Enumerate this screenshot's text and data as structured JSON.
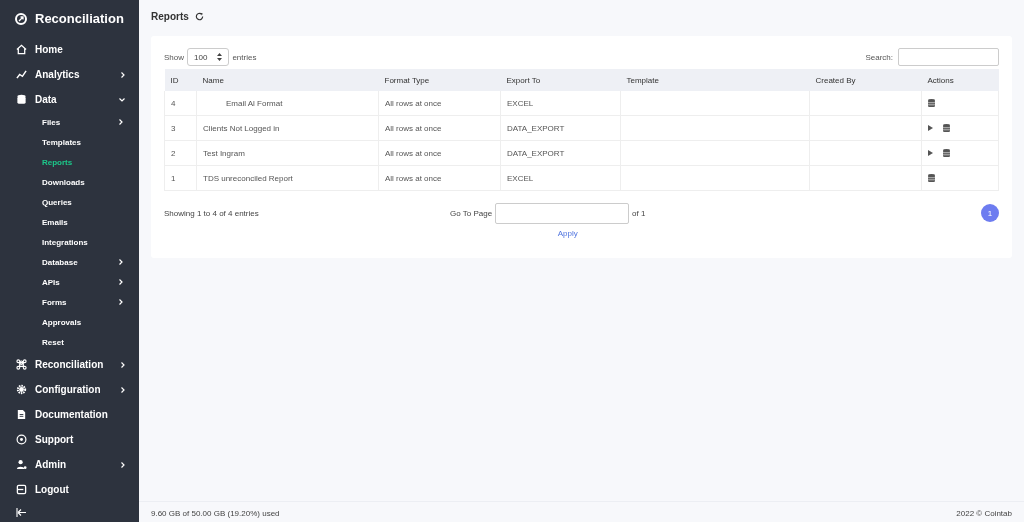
{
  "brand": "Reconciliation",
  "nav": [
    {
      "label": "Home",
      "expandable": false
    },
    {
      "label": "Analytics",
      "expandable": true,
      "expanded": false
    },
    {
      "label": "Data",
      "expandable": true,
      "expanded": true,
      "children": [
        {
          "label": "Files",
          "expandable": true,
          "selected": false
        },
        {
          "label": "Templates",
          "expandable": false,
          "selected": false
        },
        {
          "label": "Reports",
          "expandable": false,
          "selected": true
        },
        {
          "label": "Downloads",
          "expandable": false,
          "selected": false
        },
        {
          "label": "Queries",
          "expandable": false,
          "selected": false
        },
        {
          "label": "Emails",
          "expandable": false,
          "selected": false
        },
        {
          "label": "Integrations",
          "expandable": false,
          "selected": false
        },
        {
          "label": "Database",
          "expandable": true,
          "selected": false
        },
        {
          "label": "APIs",
          "expandable": true,
          "selected": false
        },
        {
          "label": "Forms",
          "expandable": true,
          "selected": false
        },
        {
          "label": "Approvals",
          "expandable": false,
          "selected": false
        },
        {
          "label": "Reset",
          "expandable": false,
          "selected": false
        }
      ]
    },
    {
      "label": "Reconciliation",
      "expandable": true,
      "expanded": false
    },
    {
      "label": "Configuration",
      "expandable": true,
      "expanded": false
    },
    {
      "label": "Documentation",
      "expandable": false
    },
    {
      "label": "Support",
      "expandable": false
    },
    {
      "label": "Admin",
      "expandable": true,
      "expanded": false
    },
    {
      "label": "Logout",
      "expandable": false
    }
  ],
  "page_title": "Reports",
  "show_label": "Show",
  "page_size": "100",
  "entries_label": "entries",
  "search_label": "Search:",
  "table": {
    "columns": [
      "ID",
      "Name",
      "Format Type",
      "Export To",
      "Template",
      "Created By",
      "Actions"
    ],
    "rows": [
      {
        "id": "4",
        "name": "Email Al Format",
        "indented": true,
        "format": "All rows at once",
        "export": "EXCEL",
        "actions": [
          {
            "kind": "database"
          }
        ]
      },
      {
        "id": "3",
        "name": "Clients Not Logged in",
        "indented": false,
        "format": "All rows at once",
        "export": "DATA_EXPORT",
        "actions": [
          {
            "kind": "run"
          },
          {
            "kind": "database"
          }
        ]
      },
      {
        "id": "2",
        "name": "Test Ingram",
        "indented": false,
        "format": "All rows at once",
        "export": "DATA_EXPORT",
        "actions": [
          {
            "kind": "run"
          },
          {
            "kind": "database"
          }
        ]
      },
      {
        "id": "1",
        "name": "TDS unreconciled Report",
        "indented": false,
        "format": "All rows at once",
        "export": "EXCEL",
        "actions": [
          {
            "kind": "database"
          }
        ]
      }
    ]
  },
  "info": "Showing 1 to 4 of 4 entries",
  "goto_label": "Go To Page",
  "goto_of": "of 1",
  "apply": "Apply",
  "pages": [
    {
      "label": "1",
      "selected": true
    }
  ],
  "footer": {
    "usage": "9.60 GB of 50.00 GB (19.20%) used",
    "copyright": "2022 © Cointab"
  }
}
